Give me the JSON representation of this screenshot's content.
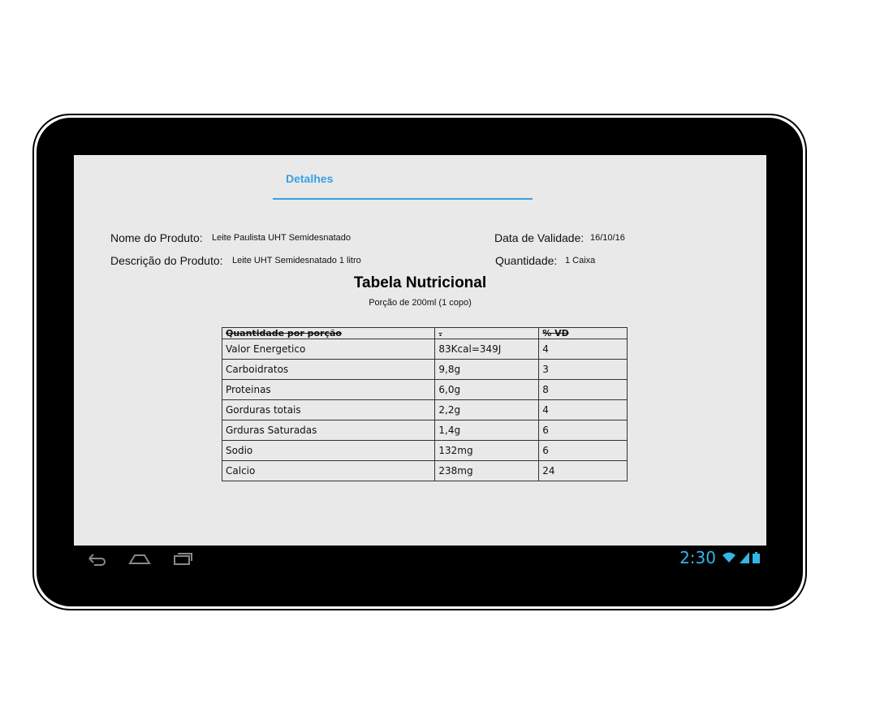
{
  "tab": {
    "label": "Detalhes"
  },
  "product": {
    "name_label": "Nome do Produto:",
    "name_value": "Leite Paulista UHT Semidesnatado",
    "description_label": "Descrição do Produto:",
    "description_value": "Leite UHT Semidesnatado 1 litro",
    "expiry_label": "Data de Validade:",
    "expiry_value": "16/10/16",
    "quantity_label": "Quantidade:",
    "quantity_value": "1 Caixa"
  },
  "nutrition": {
    "title": "Tabela Nutricional",
    "portion": "Porção de 200ml (1 copo)",
    "headers": [
      "Quantidade por porção",
      ".",
      "% VD"
    ],
    "rows": [
      [
        "Valor Energetico",
        "83Kcal=349J",
        "4"
      ],
      [
        "Carboidratos",
        "9,8g",
        "3"
      ],
      [
        "Proteinas",
        "6,0g",
        "8"
      ],
      [
        "Gorduras totais",
        "2,2g",
        "4"
      ],
      [
        "Grduras Saturadas",
        "1,4g",
        "6"
      ],
      [
        "Sodio",
        "132mg",
        "6"
      ],
      [
        "Calcio",
        "238mg",
        "24"
      ]
    ]
  },
  "status_bar": {
    "time": "2:30",
    "icons": [
      "back-icon",
      "home-icon",
      "recent-apps-icon",
      "wifi-icon",
      "signal-icon",
      "battery-icon"
    ],
    "accent_color": "#33b5e5"
  }
}
